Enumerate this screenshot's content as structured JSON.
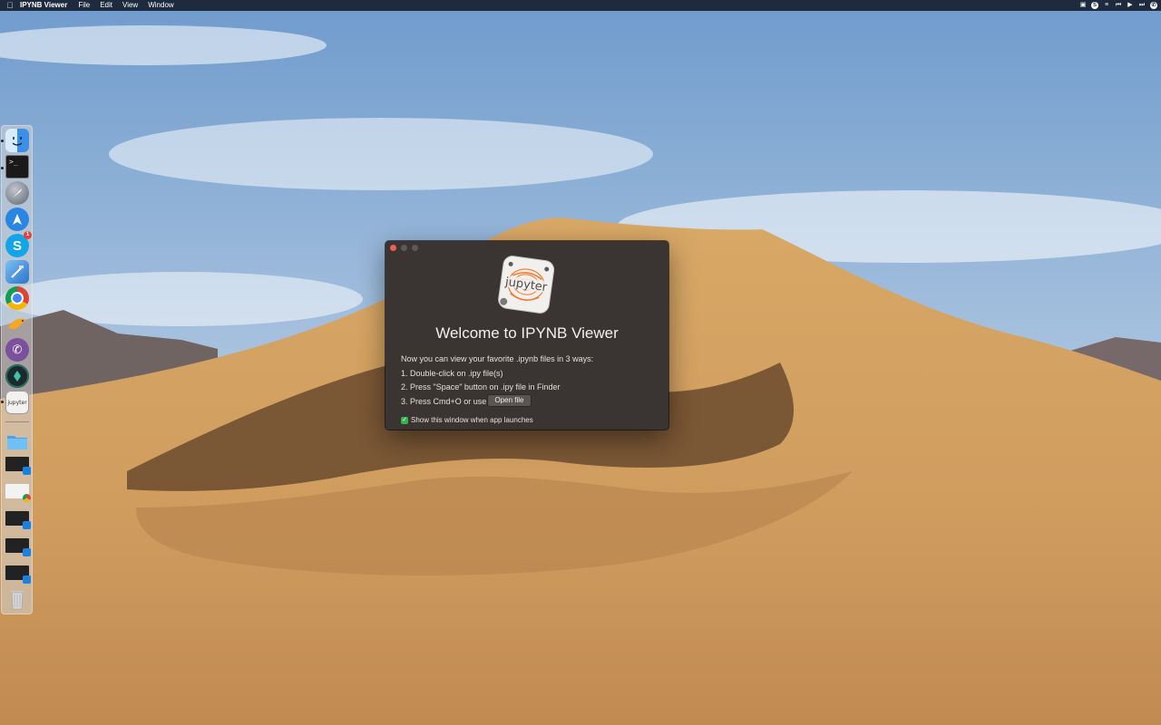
{
  "menubar": {
    "app_name": "IPYNB Viewer",
    "items": [
      "File",
      "Edit",
      "View",
      "Window"
    ],
    "status_icons": [
      "display-icon",
      "skype-icon",
      "list-icon",
      "prev-track-icon",
      "play-icon",
      "next-track-icon",
      "viber-icon"
    ]
  },
  "dock": {
    "apps": [
      "finder-icon",
      "terminal-icon",
      "launchpad-icon",
      "spark-icon",
      "skype-icon",
      "xcode-icon",
      "chrome-icon",
      "swift-icon",
      "viber-icon",
      "sketchbook-icon",
      "ipynb-viewer-icon"
    ],
    "skype_badge": "1",
    "documents": [
      "downloads-folder-icon",
      "window-thumbnail-icon",
      "chrome-window-thumbnail-icon",
      "window-thumbnail-icon",
      "window-thumbnail-icon",
      "window-thumbnail-icon",
      "trash-icon"
    ]
  },
  "window": {
    "icon_text": "jupyter",
    "title": "Welcome to IPYNB Viewer",
    "intro": "Now you can view your favorite .ipynb files in 3 ways:",
    "step1": "1. Double-click on .ipy file(s)",
    "step2": "2. Press \"Space\" button on .ipy file in Finder",
    "step3": "3. Press Cmd+O or use",
    "open_button": "Open file",
    "checkbox_label": "Show this window when app launches",
    "checkbox_checked": true
  },
  "colors": {
    "window_bg": "#3a3532",
    "close": "#ee5f56",
    "checkbox": "#37b24d",
    "jupyter_orange": "#f37726"
  }
}
